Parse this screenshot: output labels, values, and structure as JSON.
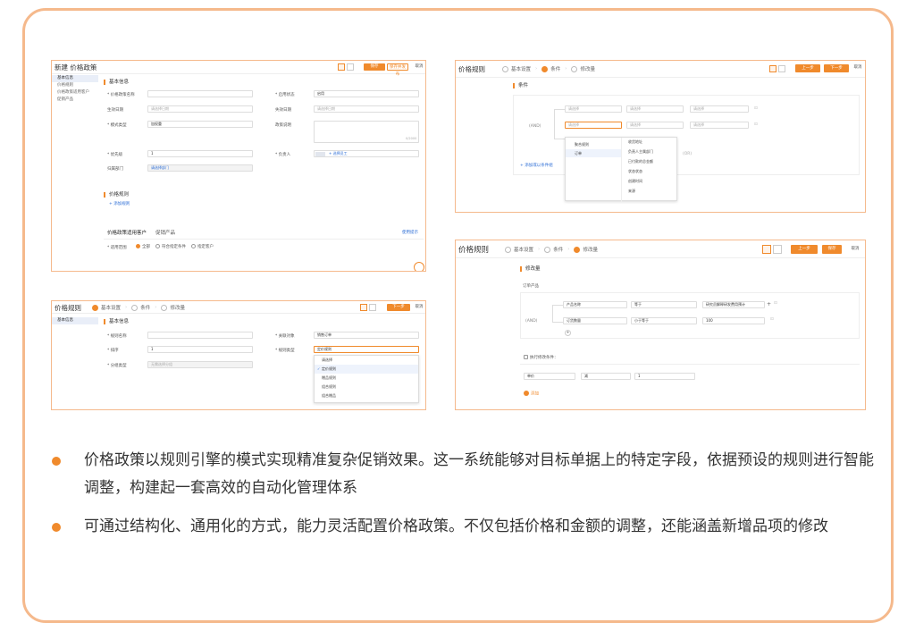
{
  "colors": {
    "accent": "#f08a2c",
    "frame": "#f5b98c",
    "link": "#2f6fd6"
  },
  "panel1": {
    "title": "新建 价格政策",
    "btn_save": "保存",
    "btn_save_publish": "保存并发布",
    "btn_cancel": "取消",
    "sidebar": [
      "基本信息",
      "价格规则",
      "价格政策适用客户",
      "促销产品"
    ],
    "section_basic": "基本信息",
    "fields": {
      "name_label": "* 价格政策名称",
      "status_label": "* 启用状态",
      "status_value": "启用",
      "start_label": "生效日期",
      "start_ph": "请选择日期",
      "end_label": "失效日期",
      "end_ph": "请选择日期",
      "type_label": "* 模式类型",
      "type_value": "加权重",
      "desc_label": "政策说明",
      "desc_count": "0/2000",
      "priority_label": "* 优先级",
      "priority_value": "1",
      "owner_label": "* 负责人",
      "owner_value": "+ 选择员工",
      "dept_label": "归属部门",
      "dept_ph": "请选择部门"
    },
    "section_rules": "价格规则",
    "add_rule": "+ 添加规则",
    "tabs": [
      "价格政策适用客户",
      "促销产品"
    ],
    "usage_link": "使用提示",
    "scope_label": "* 适用范围",
    "scope_options": [
      "全部",
      "符合指定条件",
      "指定客户"
    ]
  },
  "panel2": {
    "title": "价格规则",
    "steps": [
      "基本设置",
      "条件",
      "修改量"
    ],
    "btn_prev": "上一步",
    "btn_next": "下一步",
    "btn_cancel": "取消",
    "section": "条件",
    "and_label": "(AND)",
    "select_ph": "请选择",
    "menu_left": [
      "聚合规则",
      "订单"
    ],
    "menu_right": [
      "收货地址",
      "负责人主属部门",
      "已付款的总金额",
      "状态状态",
      "创建时间",
      "来源"
    ],
    "add_group": "+ 添加或以条件组",
    "or_label": "(OR)"
  },
  "panel3": {
    "title": "价格规则",
    "steps": [
      "基本设置",
      "条件",
      "修改量"
    ],
    "btn_next": "下一步",
    "btn_cancel": "取消",
    "sidebar": [
      "基本信息"
    ],
    "section": "基本信息",
    "rule_name_label": "* 规则名称",
    "object_label": "* 关联对象",
    "object_value": "销售订单",
    "priority_label": "* 排序",
    "priority_value": "1",
    "rule_type_label": "* 规则类型",
    "rule_type_value": "定价规则",
    "category_label": "* 分组类型",
    "category_ph": "无需选择分组",
    "dropdown": [
      "请选择",
      "定价规则",
      "赠品规则",
      "组合规则",
      "组合赠品"
    ]
  },
  "panel4": {
    "title": "价格规则",
    "steps": [
      "基本设置",
      "条件",
      "修改量"
    ],
    "btn_prev": "上一步",
    "btn_finish": "保存",
    "btn_cancel": "取消",
    "section": "修改量",
    "sub_section": "订单产品",
    "and_label": "(AND)",
    "row1": [
      "产品名称",
      "等于",
      "研究员解释研发费用预计"
    ],
    "row2": [
      "订货数量",
      "小于等于",
      "100"
    ],
    "exec_label": "执行修改条件：",
    "row3": [
      "单价",
      "减",
      "1"
    ],
    "add": "添加"
  },
  "bullets": [
    "价格政策以规则引擎的模式实现精准复杂促销效果。这一系统能够对目标单据上的特定字段，依据预设的规则进行智能调整，构建起一套高效的自动化管理体系",
    "可通过结构化、通用化的方式，能力灵活配置价格政策。不仅包括价格和金额的调整，还能涵盖新增品项的修改"
  ]
}
